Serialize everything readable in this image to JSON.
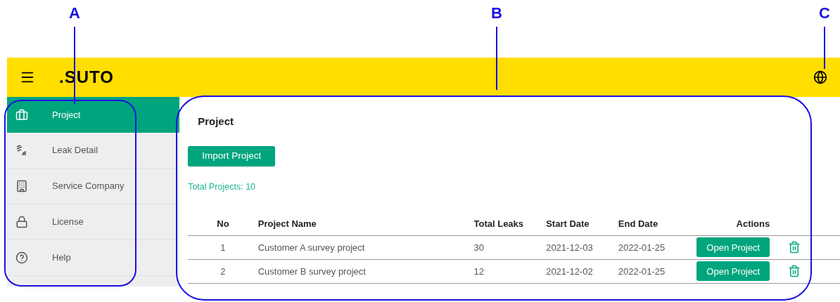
{
  "callouts": [
    {
      "label": "A"
    },
    {
      "label": "B"
    },
    {
      "label": "C"
    }
  ],
  "header": {
    "logo": ".SUTO"
  },
  "sidebar": {
    "items": [
      {
        "label": "Project",
        "kind": "briefcase",
        "selected": true
      },
      {
        "label": "Leak Detail",
        "kind": "leak",
        "selected": false
      },
      {
        "label": "Service Company",
        "kind": "building",
        "selected": false
      },
      {
        "label": "License",
        "kind": "lock",
        "selected": false
      },
      {
        "label": "Help",
        "kind": "help",
        "selected": false
      }
    ]
  },
  "main": {
    "title": "Project",
    "import_button": "Import Project",
    "total": "Total Projects: 10",
    "table": {
      "columns": [
        "No",
        "Project Name",
        "Total Leaks",
        "Start Date",
        "End Date",
        "Actions"
      ],
      "rows": [
        {
          "no": "1",
          "name": "Customer A survey project",
          "leaks": "30",
          "start": "2021-12-03",
          "end": "2022-01-25",
          "action": "Open Project"
        },
        {
          "no": "2",
          "name": "Customer B survey project",
          "leaks": "12",
          "start": "2021-12-02",
          "end": "2022-01-25",
          "action": "Open Project"
        }
      ]
    }
  }
}
